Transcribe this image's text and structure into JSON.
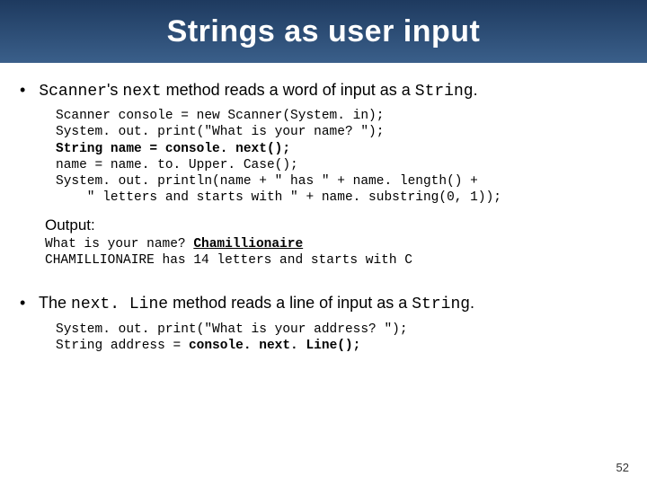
{
  "title": "Strings as user input",
  "bullet1": {
    "pre": "Scanner",
    "mid1": "'s ",
    "code2": "next",
    "mid2": " method reads a word of input as a ",
    "code3": "String",
    "end": "."
  },
  "code1": {
    "l1": "Scanner console = new Scanner(System. in);",
    "l2": "System. out. print(\"What is your name? \");",
    "l3": "String name = console. next();",
    "l4": "name = name. to. Upper. Case();",
    "l5": "System. out. println(name + \" has \" + name. length() +",
    "l6": "    \" letters and starts with \" + name. substring(0, 1));"
  },
  "output_label": "Output:",
  "output": {
    "q": "What is your name? ",
    "input": "Chamillionaire",
    "result": "CHAMILLIONAIRE has 14 letters and starts with C"
  },
  "bullet2": {
    "pre": "The ",
    "code1": "next. Line",
    "mid": " method reads a line of input as a ",
    "code2": "String",
    "end": "."
  },
  "code2": {
    "l1": "System. out. print(\"What is your address? \");",
    "l2a": "String address = ",
    "l2b": "console. next. Line();"
  },
  "page_number": "52"
}
